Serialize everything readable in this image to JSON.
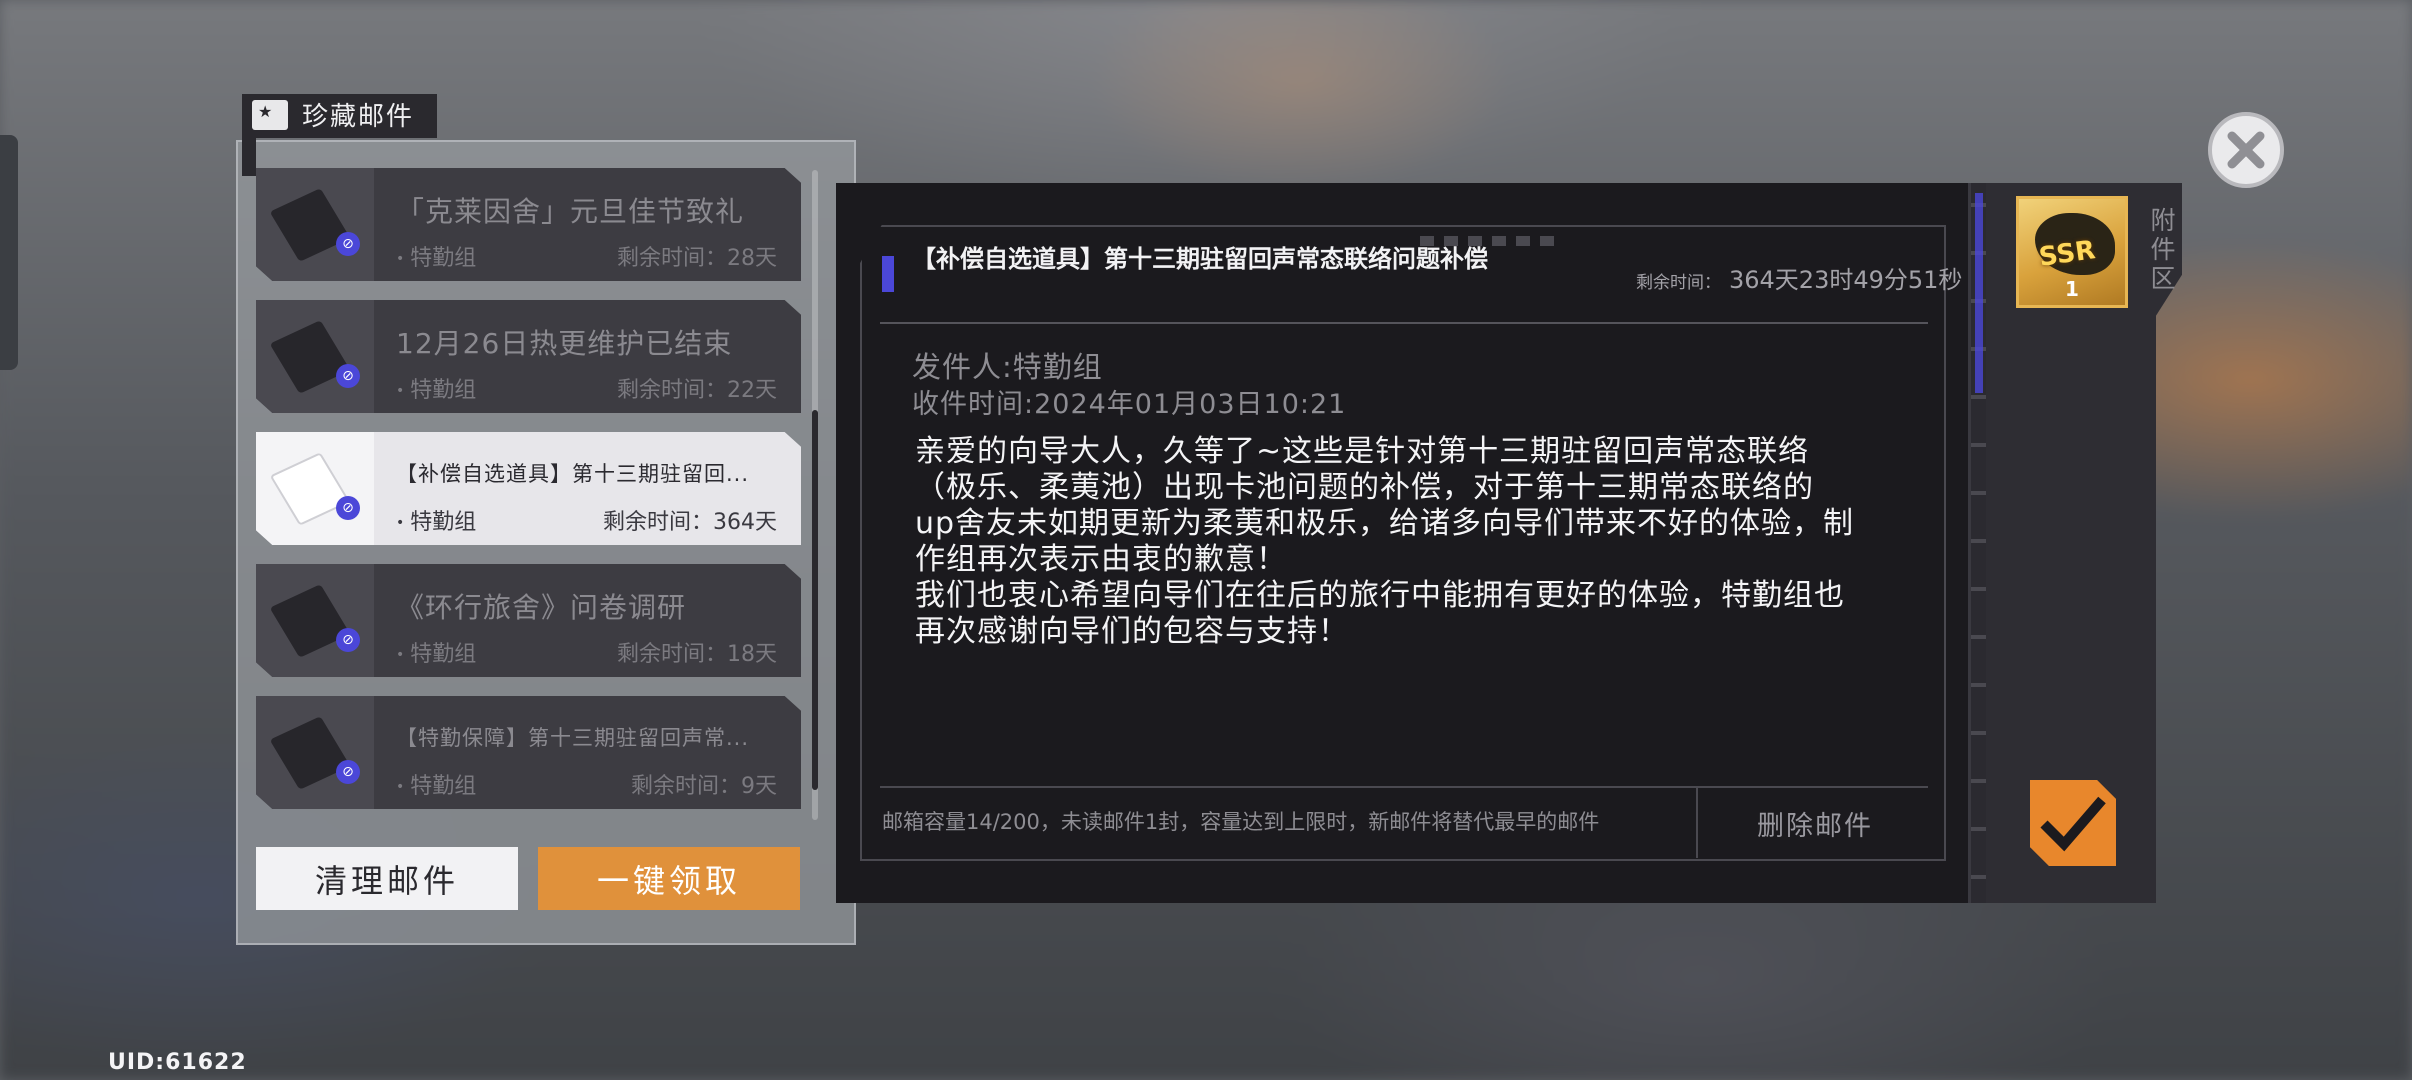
{
  "list": {
    "title": "珍藏邮件",
    "items": [
      {
        "title": "「克莱因舍」元旦佳节致礼",
        "sender": "特勤组",
        "remain": "剩余时间：28天"
      },
      {
        "title": "12月26日热更维护已结束",
        "sender": "特勤组",
        "remain": "剩余时间：22天"
      },
      {
        "title": "【补偿自选道具】第十三期驻留回...",
        "sender": "特勤组",
        "remain": "剩余时间：364天"
      },
      {
        "title": "《环行旅舍》问卷调研",
        "sender": "特勤组",
        "remain": "剩余时间：18天"
      },
      {
        "title": "【特勤保障】第十三期驻留回声常...",
        "sender": "特勤组",
        "remain": "剩余时间：9天"
      }
    ],
    "clean_label": "清理邮件",
    "claim_all_label": "一键领取"
  },
  "detail": {
    "subject": "【补偿自选道具】第十三期驻留回声常态联络问题补偿",
    "remain_label": "剩余时间：",
    "remain_value": "364天23时49分51秒",
    "sender": "发件人:特勤组",
    "received": "收件时间:2024年01月03日10:21",
    "body": "亲爱的向导大人，久等了~这些是针对第十三期驻留回声常态联络\n（极乐、柔荑池）出现卡池问题的补偿，对于第十三期常态联络的\nup舍友未如期更新为柔荑和极乐，给诸多向导们带来不好的体验，制\n作组再次表示由衷的歉意！\n我们也衷心希望向导们在往后的旅行中能拥有更好的体验，特勤组也\n再次感谢向导们的包容与支持！",
    "footer_note": "邮箱容量14/200，未读邮件1封，容量达到上限时，新邮件将替代最早的邮件",
    "delete_label": "删除邮件"
  },
  "attachments": {
    "label": "附件区",
    "items": [
      {
        "badge": "SSR",
        "count": "1",
        "icon": "ssr-item-icon"
      }
    ]
  },
  "uid": "UID:61622",
  "colors": {
    "accent_orange": "#e0913b",
    "accent_blue": "#4b47d8",
    "panel_dark": "#1b1a1e"
  }
}
